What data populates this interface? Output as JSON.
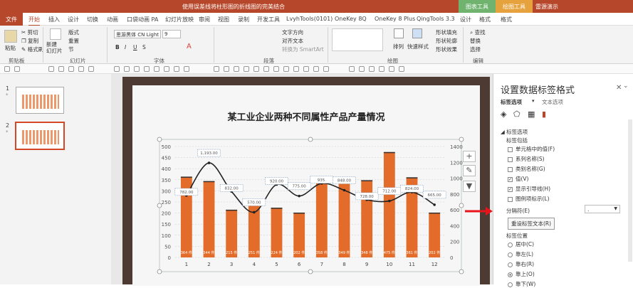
{
  "titlebar": {
    "doc": "使用误差线将柱形图的折线图的完美结合",
    "ctx1": "图表工具",
    "ctx2": "绘图工具",
    "login": "雷源演示"
  },
  "tabs": [
    "文件",
    "开始",
    "插入",
    "设计",
    "切换",
    "动画",
    "口袋动画 PA",
    "幻灯片放映",
    "审阅",
    "视图",
    "录制",
    "开发工具",
    "LvyhTools(0101)",
    "OneKey 8Q",
    "OneKey 8 Plus",
    "QingTools 3.3",
    "设计",
    "格式",
    "格式"
  ],
  "ribbon": {
    "paste": "粘贴",
    "cut": "剪切",
    "copy": "复制",
    "painter": "格式刷",
    "newslide": "新建\n幻灯片",
    "layout": "版式",
    "reset": "重置",
    "section": "节",
    "font": "思源黑体 CN Light",
    "size": "9",
    "textdir": "文字方向",
    "align": "对齐文本",
    "smartart": "转换为 SmartArt",
    "arrange": "排列",
    "quickstyle": "快速样式",
    "fill": "形状填充",
    "outline": "形状轮廓",
    "effect": "形状效果",
    "find": "查找",
    "replace": "替换",
    "select": "选择",
    "groups": [
      "剪贴板",
      "幻灯片",
      "字体",
      "段落",
      "绘图",
      "编辑"
    ]
  },
  "slides": [
    {
      "num": "1"
    },
    {
      "num": "2"
    }
  ],
  "chart_data": {
    "type": "bar",
    "title": "某工业企业两种不同属性产品产量情况",
    "categories": [
      "1",
      "2",
      "3",
      "4",
      "5",
      "6",
      "7",
      "8",
      "9",
      "10",
      "11",
      "12"
    ],
    "series": [
      {
        "values": [
          364,
          344,
          215,
          251,
          224,
          202,
          358,
          349,
          348,
          475,
          361,
          202
        ],
        "labels": [
          "364 件",
          "344 件",
          "215 件",
          "251 件",
          "224 件",
          "202 件",
          "358 件",
          "349 件",
          "348 件",
          "475 件",
          "361 件",
          "202 件"
        ]
      },
      {
        "values": [
          782,
          1193,
          832,
          570,
          920,
          775,
          935,
          848,
          728,
          712,
          824,
          665
        ],
        "labels": [
          "782.00",
          "1,193.00",
          "832.00",
          "570.00",
          "920.00",
          "775.00",
          "935.",
          "848.00",
          "728.00",
          "712.00",
          "824.00",
          "665.00"
        ]
      }
    ],
    "ylim": [
      0,
      500
    ],
    "y2lim": [
      0,
      1400
    ],
    "yticks": [
      "0",
      "50",
      "100",
      "150",
      "200",
      "250",
      "300",
      "350",
      "400",
      "450",
      "500"
    ],
    "y2ticks": [
      "0",
      "200",
      "400",
      "600",
      "800",
      "1000",
      "1200",
      "1400"
    ]
  },
  "pane": {
    "title": "设置数据标签格式",
    "tab1": "标签选项",
    "tab2": "文本选项",
    "section": "标签选项",
    "contains": "标签包括",
    "options": [
      {
        "label": "单元格中的值(F)",
        "checked": false
      },
      {
        "label": "系列名称(S)",
        "checked": false
      },
      {
        "label": "类别名称(G)",
        "checked": false
      },
      {
        "label": "值(V)",
        "checked": true
      },
      {
        "label": "显示引导线(H)",
        "checked": true
      },
      {
        "label": "图例项标示(L)",
        "checked": false
      }
    ],
    "separator": "分隔符(E)",
    "separator_value": ".",
    "reset": "重设标签文本(R)",
    "position": "标签位置",
    "positions": [
      {
        "label": "居中(C)",
        "on": false
      },
      {
        "label": "靠左(L)",
        "on": false
      },
      {
        "label": "靠右(R)",
        "on": false
      },
      {
        "label": "靠上(O)",
        "on": true
      },
      {
        "label": "靠下(W)",
        "on": false
      }
    ]
  },
  "colors": {
    "bar": "#e46c2a",
    "accent": "#b7472a",
    "arrow": "#e8141b"
  }
}
